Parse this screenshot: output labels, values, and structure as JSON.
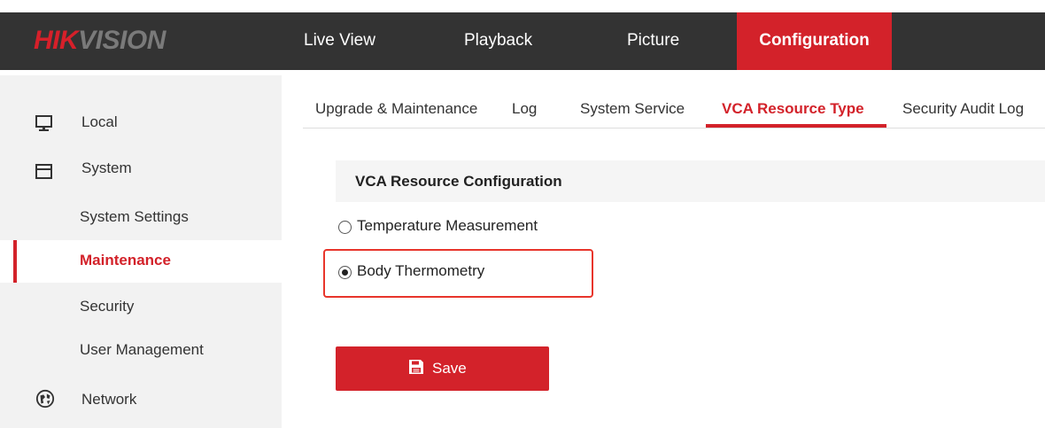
{
  "brand": {
    "logo_red": "HIK",
    "logo_gray": "VISION"
  },
  "topnav": {
    "items": [
      {
        "label": "Live View",
        "active": false
      },
      {
        "label": "Playback",
        "active": false
      },
      {
        "label": "Picture",
        "active": false
      },
      {
        "label": "Configuration",
        "active": true
      }
    ]
  },
  "sidebar": {
    "items": [
      {
        "label": "Local",
        "icon": "monitor-icon",
        "level": "top",
        "active": false
      },
      {
        "label": "System",
        "icon": "window-icon",
        "level": "top",
        "active": false
      },
      {
        "label": "System Settings",
        "level": "sub",
        "active": false
      },
      {
        "label": "Maintenance",
        "level": "sub",
        "active": true
      },
      {
        "label": "Security",
        "level": "sub",
        "active": false
      },
      {
        "label": "User Management",
        "level": "sub",
        "active": false
      },
      {
        "label": "Network",
        "icon": "globe-icon",
        "level": "top",
        "active": false
      }
    ]
  },
  "tabs": [
    {
      "label": "Upgrade & Maintenance",
      "active": false
    },
    {
      "label": "Log",
      "active": false
    },
    {
      "label": "System Service",
      "active": false
    },
    {
      "label": "VCA Resource Type",
      "active": true
    },
    {
      "label": "Security Audit Log",
      "active": false
    }
  ],
  "section": {
    "title": "VCA Resource Configuration"
  },
  "options": [
    {
      "label": "Temperature Measurement",
      "selected": false
    },
    {
      "label": "Body Thermometry",
      "selected": true
    }
  ],
  "save_button": {
    "label": "Save",
    "icon": "floppy-disk-icon"
  },
  "colors": {
    "accent": "#d3222a",
    "topbar": "#333333",
    "sidebar": "#f2f2f2",
    "highlight": "#e8352b"
  }
}
